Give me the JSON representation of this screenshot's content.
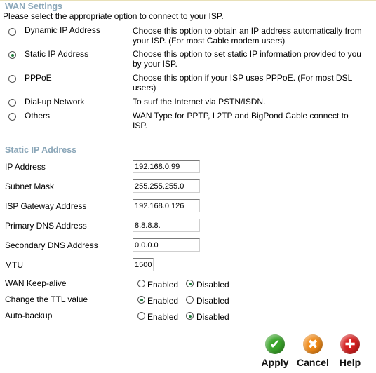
{
  "wan": {
    "title": "WAN Settings",
    "intro": "Please select the appropriate option to connect to your ISP.",
    "options": [
      {
        "label": "Dynamic IP Address",
        "desc": "Choose this option to obtain an IP address automatically from your ISP. (For most Cable modem users)",
        "checked": false
      },
      {
        "label": "Static IP Address",
        "desc": "Choose this option to set static IP information provided to you by your ISP.",
        "checked": true
      },
      {
        "label": "PPPoE",
        "desc": "Choose this option if your ISP uses PPPoE. (For most DSL users)",
        "checked": false
      },
      {
        "label": "Dial-up Network",
        "desc": "To surf the Internet via PSTN/ISDN.",
        "checked": false
      },
      {
        "label": "Others",
        "desc": "WAN Type for PPTP, L2TP and BigPond Cable connect to ISP.",
        "checked": false
      }
    ]
  },
  "static": {
    "title": "Static IP Address",
    "fields": [
      {
        "label": "IP Address",
        "value": "192.168.0.99"
      },
      {
        "label": "Subnet Mask",
        "value": "255.255.255.0"
      },
      {
        "label": "ISP Gateway Address",
        "value": "192.168.0.126"
      },
      {
        "label": "Primary DNS Address",
        "value": "8.8.8.8."
      },
      {
        "label": "Secondary DNS Address",
        "value": "0.0.0.0"
      },
      {
        "label": "MTU",
        "value": "1500"
      }
    ],
    "toggles": [
      {
        "label": "WAN Keep-alive",
        "enabled": "Enabled",
        "disabled": "Disabled",
        "selected": "disabled"
      },
      {
        "label": "Change the TTL value",
        "enabled": "Enabled",
        "disabled": "Disabled",
        "selected": "enabled"
      },
      {
        "label": "Auto-backup",
        "enabled": "Enabled",
        "disabled": "Disabled",
        "selected": "disabled"
      }
    ]
  },
  "buttons": {
    "apply": "Apply",
    "cancel": "Cancel",
    "help": "Help"
  },
  "colors": {
    "apply": "#3aa52a",
    "cancel": "#f08a18",
    "help": "#d62020",
    "section_title": "#8aa6b8"
  },
  "icons": {
    "apply": "check-icon",
    "cancel": "x-icon",
    "help": "plus-icon"
  }
}
